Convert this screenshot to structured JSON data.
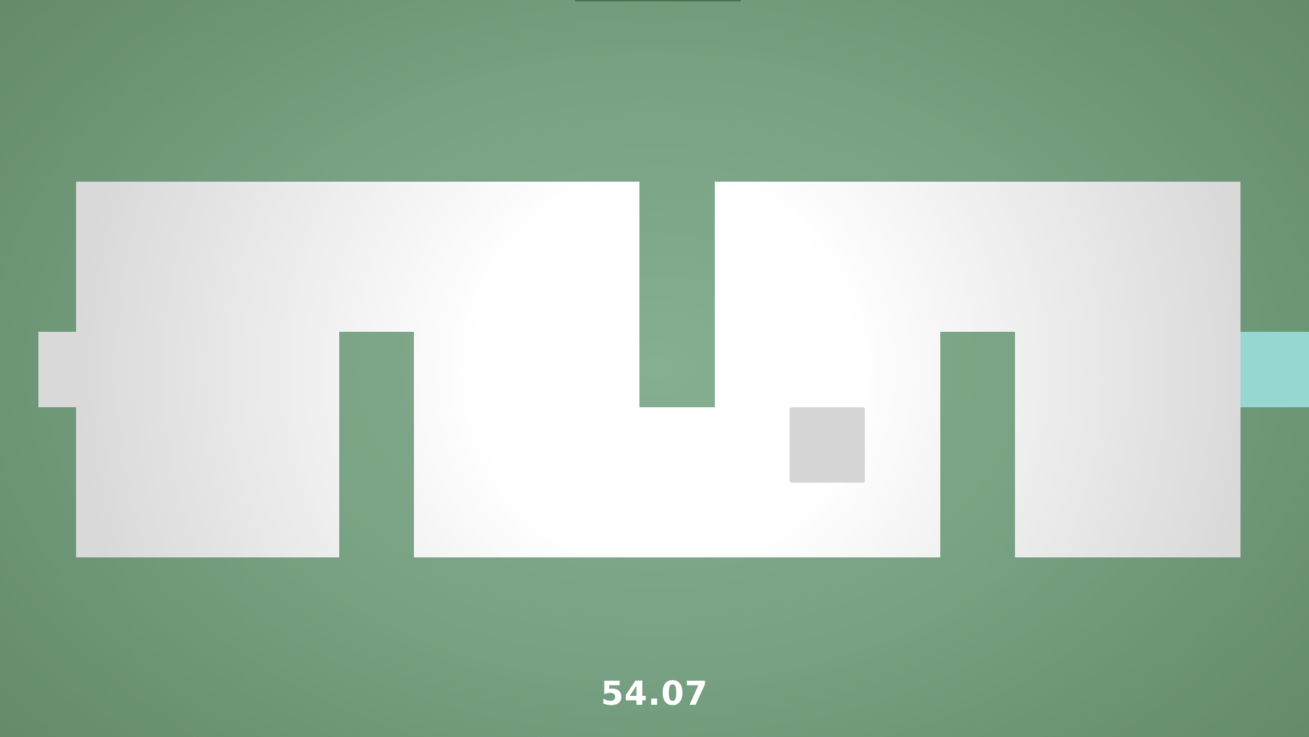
{
  "game": {
    "timer": "54.07"
  },
  "colors": {
    "background": "#78a283",
    "floor_center": "#ffffff",
    "floor_edge": "#d9d9d9",
    "player_block": "#d6d6d6",
    "exit_tile": "#97d7d2"
  },
  "icons": {
    "player": "square-block-icon",
    "exit": "exit-tile-icon"
  }
}
